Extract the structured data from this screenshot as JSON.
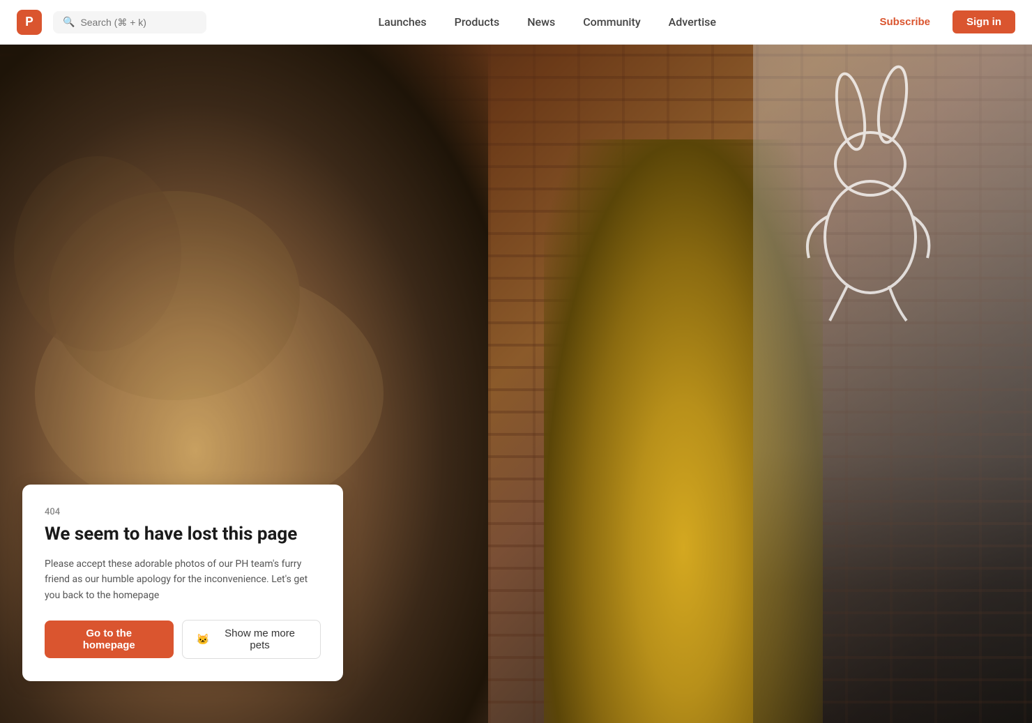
{
  "navbar": {
    "logo_letter": "P",
    "search_placeholder": "Search (⌘ + k)",
    "nav_items": [
      {
        "label": "Launches",
        "id": "launches"
      },
      {
        "label": "Products",
        "id": "products"
      },
      {
        "label": "News",
        "id": "news"
      },
      {
        "label": "Community",
        "id": "community"
      },
      {
        "label": "Advertise",
        "id": "advertise"
      }
    ],
    "subscribe_label": "Subscribe",
    "signin_label": "Sign in"
  },
  "error": {
    "code": "404",
    "title": "We seem to have lost this page",
    "description": "Please accept these adorable photos of our PH team's furry friend as our humble apology for the inconvenience. Let's get you back to the homepage",
    "btn_homepage": "Go to the homepage",
    "btn_pets_emoji": "🐱",
    "btn_pets": "Show me more pets"
  }
}
